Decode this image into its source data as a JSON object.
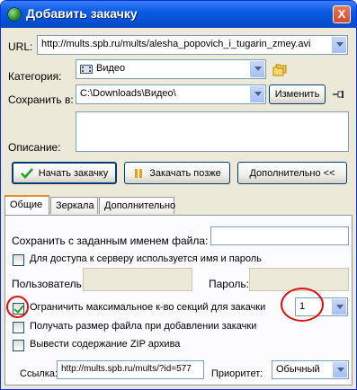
{
  "window": {
    "title": "Добавить закачку",
    "close_label": "X"
  },
  "url": {
    "label": "URL:",
    "value": "http://mults.spb.ru/mults/alesha_popovich_i_tugarin_zmey.avi"
  },
  "category": {
    "label": "Категория:",
    "value": "Видео"
  },
  "save_to": {
    "label": "Сохранить в:",
    "value": "C:\\Downloads\\Видео\\",
    "change_label": "Изменить"
  },
  "description": {
    "label": "Описание:",
    "value": ""
  },
  "actions": {
    "start": "Начать закачку",
    "later": "Закачать позже",
    "more": "Дополнительно <<"
  },
  "tabs": [
    {
      "label": "Общие"
    },
    {
      "label": "Зеркала"
    },
    {
      "label": "Дополнительно"
    }
  ],
  "general": {
    "save_as_label": "Сохранить с заданным именем файла:",
    "save_as_value": "",
    "auth_checkbox": {
      "label": "Для доступа к серверу используется имя и пароль",
      "checked": false
    },
    "user_label": "Пользователь:",
    "password_label": "Пароль:",
    "limit_sections": {
      "label": "Ограничить максимальное к-во секций для закачки",
      "checked": true,
      "value": "1"
    },
    "get_size": {
      "label": "Получать размер файла при добавлении закачки",
      "checked": false
    },
    "zip_contents": {
      "label": "Вывести содержание ZIP архива",
      "checked": false
    },
    "referer_label": "Ссылка:",
    "referer_value": "http://mults.spb.ru/mults/?id=577",
    "priority_label": "Приоритет:",
    "priority_value": "Обычный"
  },
  "colors": {
    "titlebar": "#0453d6",
    "highlight_circle": "#e01010",
    "check": "#21a121"
  }
}
